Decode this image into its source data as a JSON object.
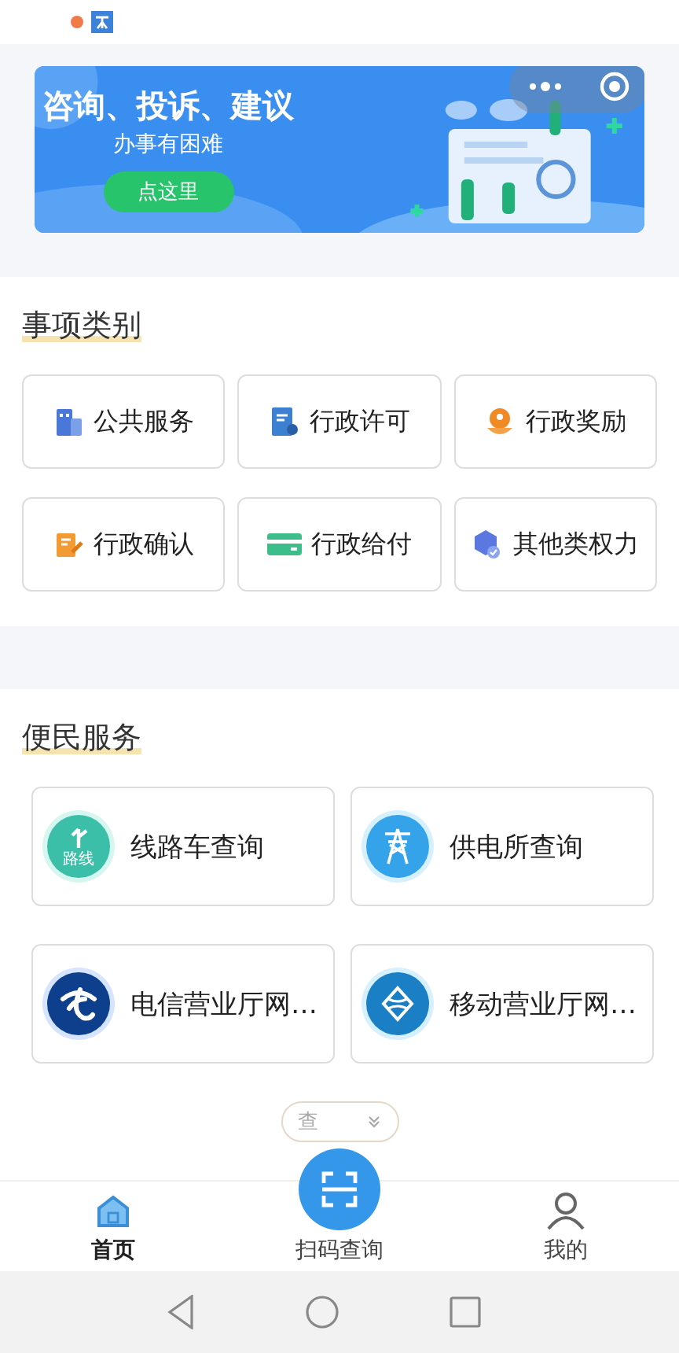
{
  "banner": {
    "title": "咨询、投诉、建议",
    "subtitle": "办事有困难",
    "button": "点这里"
  },
  "categories": {
    "title": "事项类别",
    "items": [
      {
        "label": "公共服务",
        "kind": "building"
      },
      {
        "label": "行政许可",
        "kind": "permit"
      },
      {
        "label": "行政奖励",
        "kind": "award"
      },
      {
        "label": "行政确认",
        "kind": "confirm"
      },
      {
        "label": "行政给付",
        "kind": "payment"
      },
      {
        "label": "其他类权力",
        "kind": "other"
      }
    ]
  },
  "services": {
    "title": "便民服务",
    "items": [
      {
        "label": "线路车查询",
        "kind": "route",
        "badge": "路线"
      },
      {
        "label": "供电所查询",
        "kind": "power"
      },
      {
        "label": "电信营业厅网…",
        "kind": "telecom"
      },
      {
        "label": "移动营业厅网…",
        "kind": "mobile"
      }
    ]
  },
  "more_pill": {
    "label": "查"
  },
  "nav": [
    {
      "label": "首页",
      "kind": "home",
      "selected": true
    },
    {
      "label": "扫码查询",
      "kind": "scan",
      "selected": false
    },
    {
      "label": "我的",
      "kind": "user",
      "selected": false
    }
  ]
}
